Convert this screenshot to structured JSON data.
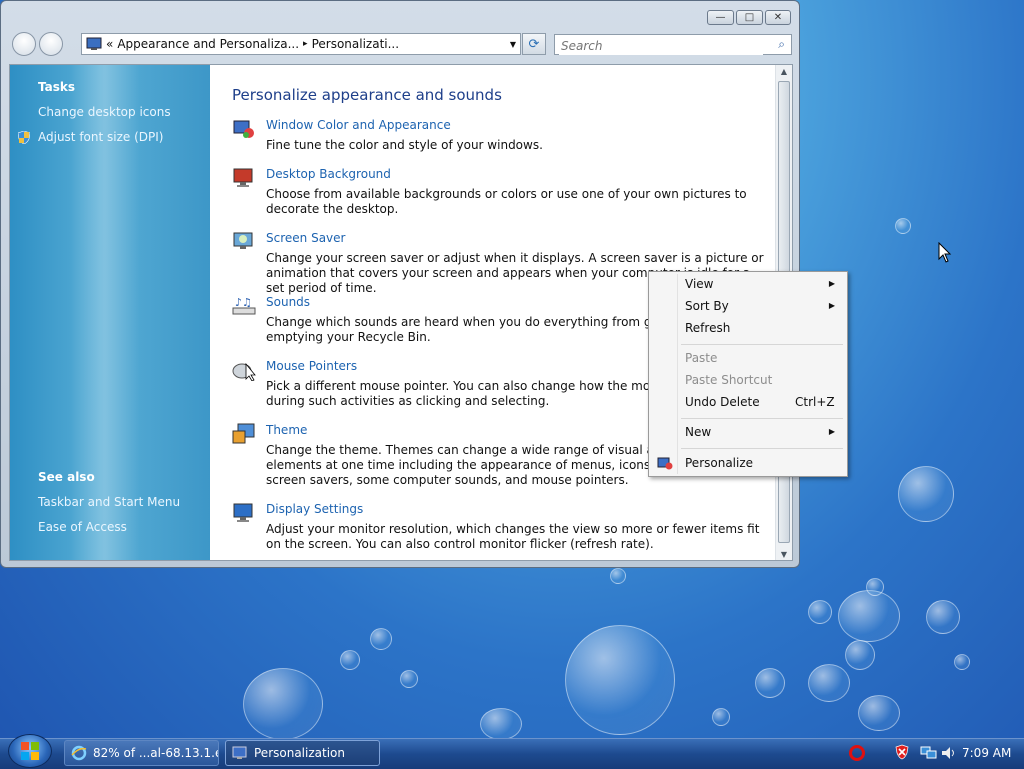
{
  "window": {
    "address": {
      "chevron": "«",
      "part1": "Appearance and Personaliza...",
      "sep": "▸",
      "part2": "Personalizati..."
    },
    "search_placeholder": "Search",
    "caption_buttons": {
      "minimize": "—",
      "maximize": "□",
      "close": "✕"
    }
  },
  "taskpane": {
    "tasks_heading": "Tasks",
    "tasks": [
      "Change desktop icons",
      "Adjust font size (DPI)"
    ],
    "see_also_heading": "See also",
    "see_also": [
      "Taskbar and Start Menu",
      "Ease of Access"
    ]
  },
  "main": {
    "heading": "Personalize appearance and sounds",
    "items": [
      {
        "title": "Window Color and Appearance",
        "desc": "Fine tune the color and style of your windows.",
        "icon": "window-color-icon"
      },
      {
        "title": "Desktop Background",
        "desc": "Choose from available backgrounds or colors or use one of your own pictures to decorate the desktop.",
        "icon": "desktop-background-icon"
      },
      {
        "title": "Screen Saver",
        "desc": "Change your screen saver or adjust when it displays. A screen saver is a picture or animation that covers your screen and appears when your computer is idle for a set period of time.",
        "icon": "screen-saver-icon"
      },
      {
        "title": "Sounds",
        "desc": "Change which sounds are heard when you do everything from getting e-mail to emptying your Recycle Bin.",
        "icon": "sounds-icon"
      },
      {
        "title": "Mouse Pointers",
        "desc": "Pick a different mouse pointer. You can also change how the mouse pointer looks during such activities as clicking and selecting.",
        "icon": "mouse-pointers-icon"
      },
      {
        "title": "Theme",
        "desc": "Change the theme. Themes can change a wide range of visual and auditory elements at one time including the appearance of menus, icons, backgrounds, screen savers, some computer sounds, and mouse pointers.",
        "icon": "theme-icon"
      },
      {
        "title": "Display Settings",
        "desc": "Adjust your monitor resolution, which changes the view so more or fewer items fit on the screen. You can also control monitor flicker (refresh rate).",
        "icon": "display-settings-icon"
      }
    ]
  },
  "context_menu": {
    "view": "View",
    "sort_by": "Sort By",
    "refresh": "Refresh",
    "paste": "Paste",
    "paste_shortcut": "Paste Shortcut",
    "undo_delete": "Undo Delete",
    "undo_shortcut": "Ctrl+Z",
    "new": "New",
    "personalize": "Personalize"
  },
  "taskbar": {
    "buttons": [
      {
        "label": "82% of ...al-68.13.1.e...",
        "icon": "internet-explorer-icon"
      },
      {
        "label": "Personalization",
        "icon": "personalization-icon"
      }
    ],
    "clock": "7:09 AM"
  },
  "colors": {
    "link": "#1d63b0",
    "heading": "#1e3f8a",
    "taskbar": "#1d4a8f"
  }
}
